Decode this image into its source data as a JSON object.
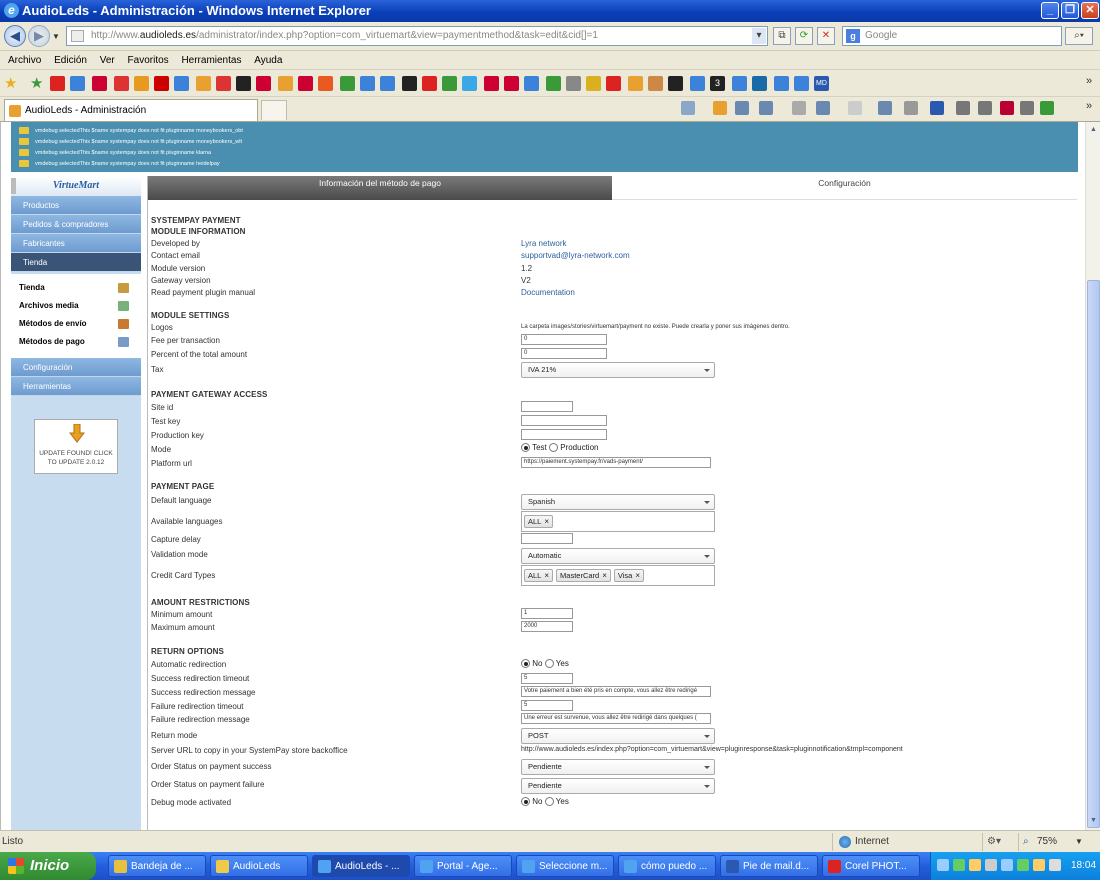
{
  "window": {
    "title": "AudioLeds - Administración - Windows Internet Explorer"
  },
  "address": {
    "url_prefix": "http://www.",
    "url_domain": "audioleds.es",
    "url_rest": "/administrator/index.php?option=com_virtuemart&view=paymentmethod&task=edit&cid[]=1",
    "search_placeholder": "Google"
  },
  "menu": [
    "Archivo",
    "Edición",
    "Ver",
    "Favoritos",
    "Herramientas",
    "Ayuda"
  ],
  "tab": {
    "label": "AudioLeds - Administración"
  },
  "debug_messages": [
    "vmdebug selectedThis $name systempay does not fit pluginname moneybookers_obt",
    "vmdebug selectedThis $name systempay does not fit pluginname moneybookers_wlt",
    "vmdebug selectedThis $name systempay does not fit pluginname klarna",
    "vmdebug selectedThis $name systempay does not fit pluginname heidelpay"
  ],
  "sidebar": {
    "logo": "VirtueMart",
    "top": [
      "Productos",
      "Pedidos & compradores",
      "Fabricantes",
      "Tienda"
    ],
    "sub": [
      "Tienda",
      "Archivos media",
      "Métodos de envío",
      "Métodos de pago"
    ],
    "bottom": [
      "Configuración",
      "Herramientas"
    ],
    "update": "UPDATE FOUND! CLICK TO UPDATE 2.0.12"
  },
  "panel_tabs": [
    "Información del método de pago",
    "Configuración"
  ],
  "form": {
    "title1": "SYSTEMPAY PAYMENT",
    "title2": "MODULE INFORMATION",
    "developed_by_label": "Developed by",
    "developed_by": "Lyra network",
    "contact_label": "Contact email",
    "contact": "supportvad@lyra-network.com",
    "module_version_label": "Module version",
    "module_version": "1.2",
    "gateway_version_label": "Gateway version",
    "gateway_version": "V2",
    "manual_label": "Read payment plugin manual",
    "manual": "Documentation",
    "settings_title": "MODULE SETTINGS",
    "logos_label": "Logos",
    "logos": "La carpeta images/stories/virtuemart/payment no existe. Puede crearla y poner sus imágenes dentro.",
    "fee_label": "Fee per transaction",
    "fee": "0",
    "percent_label": "Percent of the total amount",
    "percent": "0",
    "tax_label": "Tax",
    "tax": "IVA 21%",
    "gateway_title": "PAYMENT GATEWAY ACCESS",
    "site_id_label": "Site id",
    "site_id": "",
    "test_key_label": "Test key",
    "test_key": "",
    "prod_key_label": "Production key",
    "prod_key": "",
    "mode_label": "Mode",
    "mode_test": "Test",
    "mode_prod": "Production",
    "platform_url_label": "Platform url",
    "platform_url": "https://paiement.systempay.fr/vads-payment/",
    "page_title": "PAYMENT PAGE",
    "default_lang_label": "Default language",
    "default_lang": "Spanish",
    "avail_lang_label": "Available languages",
    "avail_lang": [
      "ALL"
    ],
    "capture_label": "Capture delay",
    "capture": "",
    "validation_label": "Validation mode",
    "validation": "Automatic",
    "cc_label": "Credit Card Types",
    "cc": [
      "ALL",
      "MasterCard",
      "Visa"
    ],
    "amount_title": "AMOUNT RESTRICTIONS",
    "min_label": "Minimum amount",
    "min": "1",
    "max_label": "Maximum amount",
    "max": "2000",
    "return_title": "RETURN OPTIONS",
    "auto_redir_label": "Automatic redirection",
    "no": "No",
    "yes": "Yes",
    "succ_timeout_label": "Success redirection timeout",
    "succ_timeout": "5",
    "succ_msg_label": "Success redirection message",
    "succ_msg": "Votre paiement a bien été pris en compte, vous allez être redirigé",
    "fail_timeout_label": "Failure redirection timeout",
    "fail_timeout": "5",
    "fail_msg_label": "Failure redirection message",
    "fail_msg": "Une erreur est survenue, vous allez être redirigé dans quelques (",
    "return_mode_label": "Return mode",
    "return_mode": "POST",
    "server_url_label": "Server URL to copy in your SystemPay store backoffice",
    "server_url": "http://www.audioleds.es/index.php?option=com_virtuemart&view=pluginresponse&task=pluginnotification&tmpl=component",
    "os_success_label": "Order Status on payment success",
    "os_success": "Pendiente",
    "os_failure_label": "Order Status on payment failure",
    "os_failure": "Pendiente",
    "debug_label": "Debug mode activated"
  },
  "status": {
    "text": "Listo",
    "zone": "Internet",
    "zoom": "75%"
  },
  "taskbar": {
    "start": "Inicio",
    "tasks": [
      "Bandeja de ...",
      "AudioLeds",
      "AudioLeds - ...",
      "Portal - Age...",
      "Seleccione m...",
      "cómo puedo ...",
      "Pie de mail.d...",
      "Corel PHOT..."
    ],
    "clock": "18:04"
  }
}
